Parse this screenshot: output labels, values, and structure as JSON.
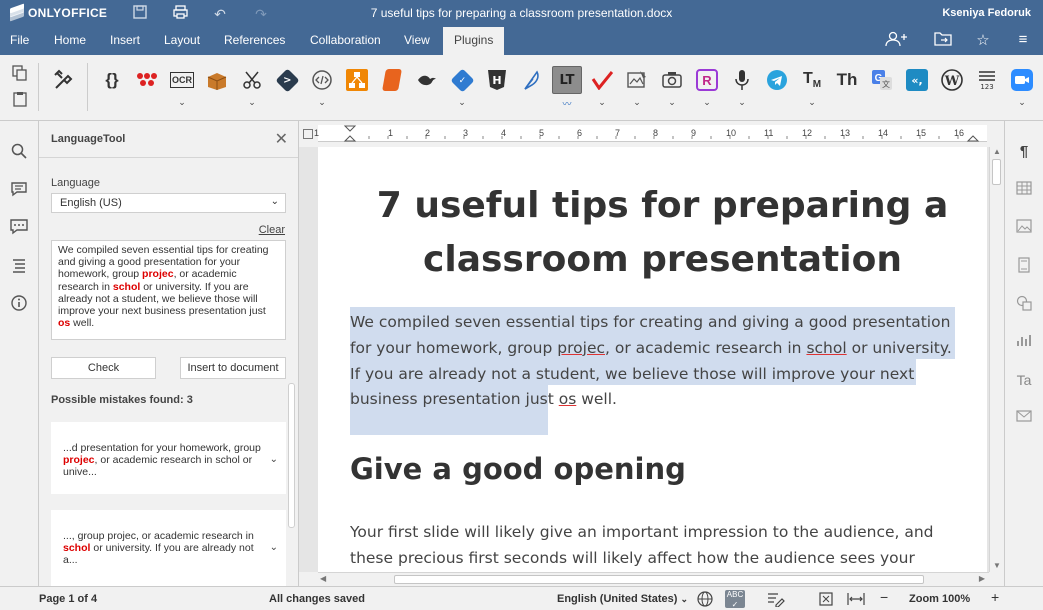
{
  "app": {
    "brand": "ONLYOFFICE",
    "doc_title": "7 useful tips for preparing a classroom presentation.docx",
    "user": "Kseniya Fedoruk"
  },
  "menu": {
    "items": [
      "File",
      "Home",
      "Insert",
      "Layout",
      "References",
      "Collaboration",
      "View",
      "Plugins"
    ],
    "active": "Plugins"
  },
  "toolbar": {
    "plugins": [
      "macros",
      "code",
      "photo-editor",
      "ocr",
      "typograf",
      "crop",
      "thesaurus",
      "html",
      "drawio",
      "slides",
      "glavred",
      "html-editor",
      "mendeley",
      "languagetool",
      "verbum",
      "diagram",
      "photo",
      "rainbow",
      "speech",
      "telegram",
      "translator",
      "text-highlighter",
      "google-translate",
      "apertium",
      "wordpress",
      "count",
      "zoom"
    ],
    "plugin_labels": {
      "ocr": "OCR",
      "languagetool": "LT",
      "tm": "TM",
      "th": "Th"
    }
  },
  "panel": {
    "title": "LanguageTool",
    "language_label": "Language",
    "language_value": "English (US)",
    "clear_label": "Clear",
    "text_parts": [
      "We compiled seven essential tips for creating and giving a good presentation for your homework, group ",
      "projec",
      ", or academic research in ",
      "schol",
      " or university. If you are already not a student, we believe those will improve your next business presentation just ",
      "os",
      " well."
    ],
    "check_label": "Check",
    "insert_label": "Insert to document",
    "mistakes_label": "Possible mistakes found: 3",
    "mistakes": [
      {
        "before": "...d presentation for your homework, group ",
        "error": "projec",
        "after": ", or academic research in schol or unive..."
      },
      {
        "before": "..., group projec, or academic research in ",
        "error": "schol",
        "after": " or university. If you are already not a..."
      }
    ]
  },
  "document": {
    "heading": "7 useful tips for preparing a classroom presentation",
    "paragraph_parts": [
      "We compiled seven essential tips for creating and giving a good presentation for your homework, group ",
      "projec",
      ", or academic research in ",
      "schol",
      " or university. If you are already not a student, we believe those will improve your next business presentation just ",
      "os",
      " well."
    ],
    "subheading": "Give a good opening",
    "paragraph2": "Your first slide will likely give an important impression to the audience, and these precious first seconds will likely affect how the audience sees your presentation"
  },
  "ruler": {
    "numbers": [
      "1",
      "1",
      "2",
      "3",
      "4",
      "5",
      "6",
      "7",
      "8",
      "9",
      "10",
      "11",
      "12",
      "13",
      "14",
      "15",
      "16"
    ]
  },
  "status": {
    "page": "Page 1 of 4",
    "saved": "All changes saved",
    "language": "English (United States)",
    "zoom": "Zoom 100%"
  },
  "colors": {
    "header": "#446995",
    "error": "#d00000",
    "selection": "#d0dcee"
  }
}
